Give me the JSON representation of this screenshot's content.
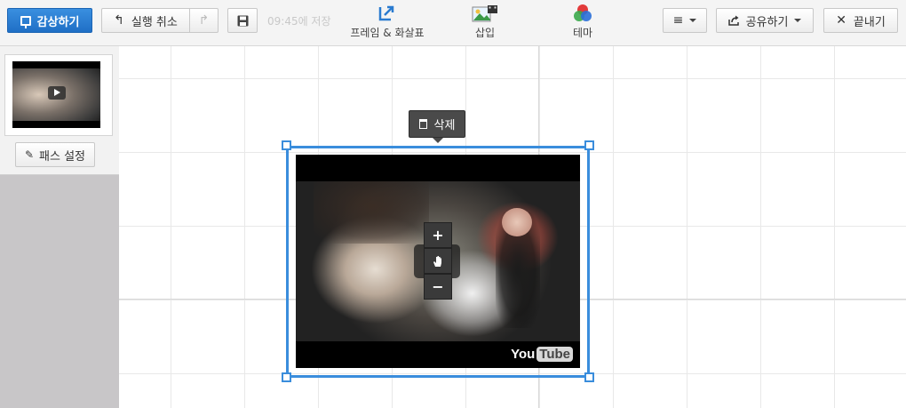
{
  "toolbar": {
    "present_label": "감상하기",
    "undo_label": "실행 취소",
    "save_status": "09:45에 저장",
    "frames_label": "프레임 & 화살표",
    "insert_label": "삽입",
    "theme_label": "테마",
    "share_label": "공유하기",
    "exit_label": "끝내기"
  },
  "sidebar": {
    "path_button_label": "패스 설정"
  },
  "canvas": {
    "delete_label": "삭제",
    "video": {
      "logo_you": "You",
      "logo_tube": "Tube"
    }
  },
  "colors": {
    "accent": "#3a8ddc",
    "primary_button": "#1f6fc6",
    "tooltip": "#4a4a4a"
  },
  "icons": [
    "present-icon",
    "undo-icon",
    "redo-icon",
    "save-icon",
    "frames-arrows-icon",
    "insert-icon",
    "theme-icon",
    "menu-icon",
    "share-icon",
    "close-icon",
    "pencil-icon",
    "trash-icon",
    "zoom-in-icon",
    "hand-icon",
    "zoom-out-icon",
    "play-icon"
  ]
}
